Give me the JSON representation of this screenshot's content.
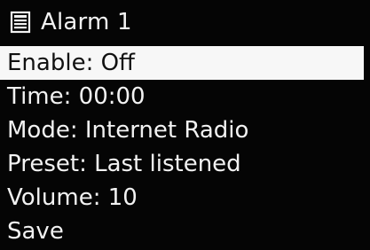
{
  "header": {
    "icon": "list-icon",
    "title": "Alarm 1"
  },
  "menu": {
    "selected_index": 0,
    "items": [
      {
        "label": "Enable: Off"
      },
      {
        "label": "Time: 00:00"
      },
      {
        "label": "Mode: Internet Radio"
      },
      {
        "label": "Preset: Last listened"
      },
      {
        "label": "Volume: 10"
      },
      {
        "label": "Save"
      }
    ]
  },
  "colors": {
    "background": "#050505",
    "text": "#f2f2f2",
    "highlight_background": "#f7f7f7",
    "highlight_text": "#111111"
  }
}
